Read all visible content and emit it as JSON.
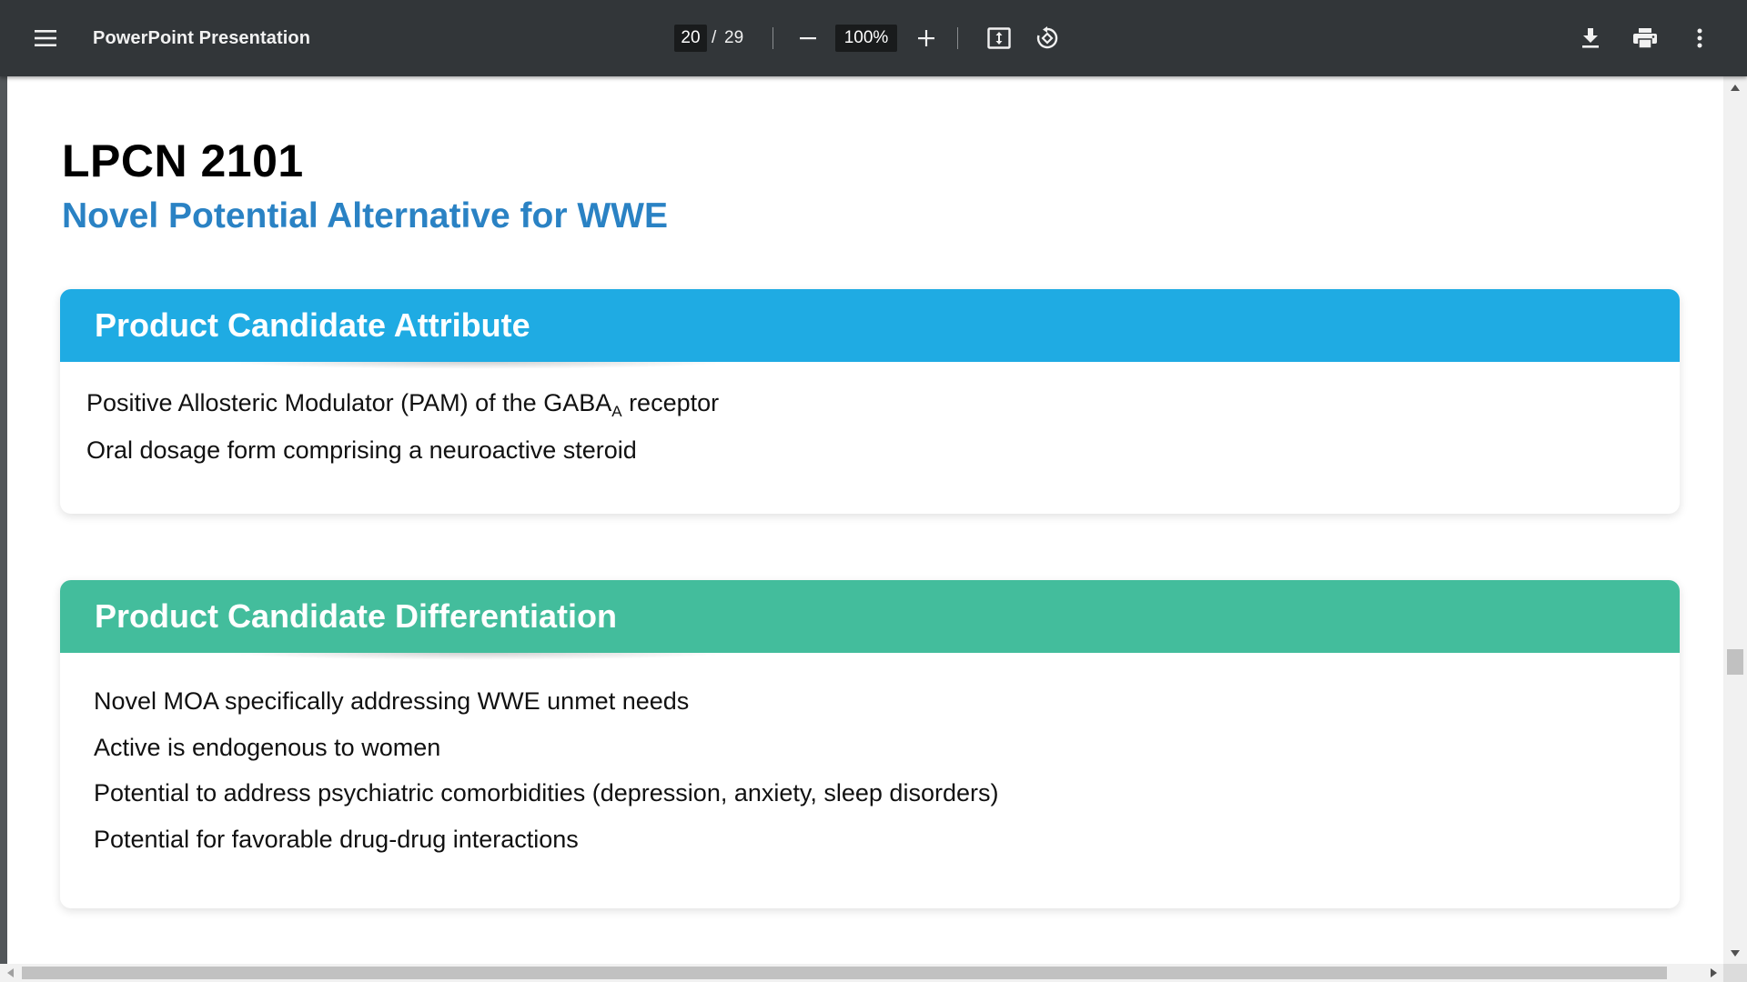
{
  "toolbar": {
    "title": "PowerPoint Presentation",
    "current_page": "20",
    "page_separator": "/",
    "total_pages": "29",
    "zoom": "100%",
    "icons": {
      "menu": "hamburger-menu-icon",
      "zoom_out": "minus-icon",
      "zoom_in": "plus-icon",
      "fit": "fit-to-page-icon",
      "rotate": "rotate-counterclockwise-icon",
      "download": "download-icon",
      "print": "print-icon",
      "more": "more-vertical-icon"
    }
  },
  "slide": {
    "title": "LPCN 2101",
    "subtitle": "Novel Potential Alternative for WWE",
    "attribute_panel": {
      "heading": "Product Candidate Attribute",
      "bullet1_prefix": "Positive Allosteric Modulator (PAM) of the GABA",
      "bullet1_sub": "A",
      "bullet1_suffix": " receptor",
      "bullet2": "Oral dosage form comprising a neuroactive steroid"
    },
    "differentiation_panel": {
      "heading": "Product Candidate Differentiation",
      "bullets": [
        "Novel MOA specifically addressing WWE unmet needs",
        "Active is endogenous to women",
        "Potential to address psychiatric comorbidities (depression, anxiety, sleep disorders)",
        "Potential for favorable drug-drug interactions"
      ]
    }
  },
  "colors": {
    "toolbar_bg": "#323639",
    "subtitle": "#2a82c4",
    "attribute_header": "#1fabe3",
    "differentiation_header": "#43bd9c"
  }
}
